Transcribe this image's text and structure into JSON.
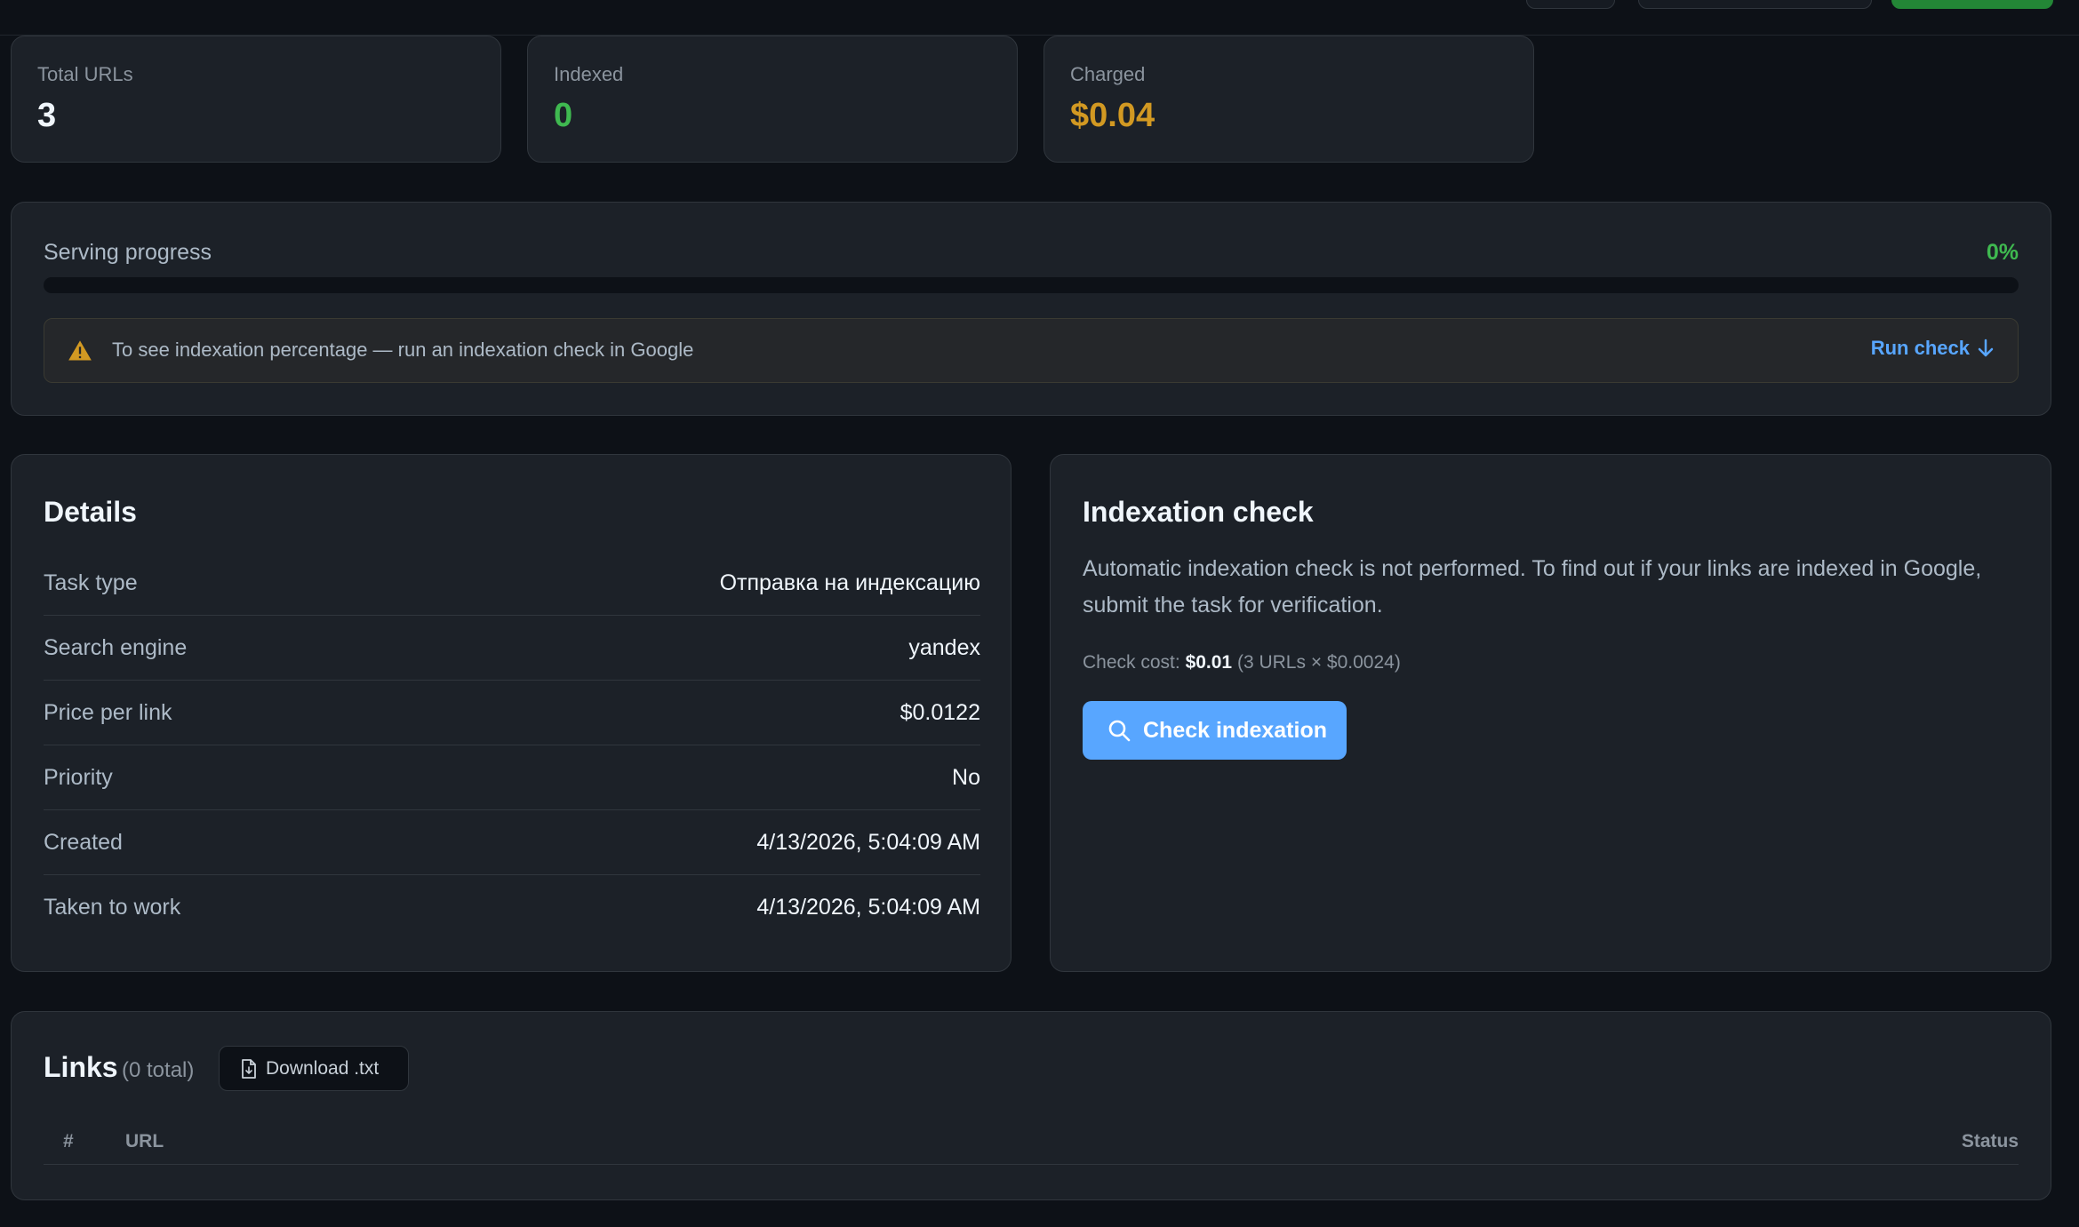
{
  "stats": {
    "total_urls_label": "Total URLs",
    "total_urls_value": "3",
    "indexed_label": "Indexed",
    "indexed_value": "0",
    "charged_label": "Charged",
    "charged_value": "$0.04"
  },
  "progress": {
    "label": "Serving progress",
    "percent_text": "0%",
    "fill_fraction": 0,
    "notice_text": "To see indexation percentage — run an indexation check in Google",
    "run_check_label": "Run check"
  },
  "details": {
    "title": "Details",
    "rows": [
      {
        "key": "Task type",
        "value": "Отправка на индексацию"
      },
      {
        "key": "Search engine",
        "value": "yandex"
      },
      {
        "key": "Price per link",
        "value": "$0.0122"
      },
      {
        "key": "Priority",
        "value": "No"
      },
      {
        "key": "Created",
        "value": "4/13/2026, 5:04:09 AM"
      },
      {
        "key": "Taken to work",
        "value": "4/13/2026, 5:04:09 AM"
      }
    ]
  },
  "indexation": {
    "title": "Indexation check",
    "description": "Automatic indexation check is not performed. To find out if your links are indexed in Google, submit the task for verification.",
    "cost_label": "Check cost:",
    "cost_value": "$0.01",
    "cost_detail": "(3 URLs × $0.0024)",
    "button_label": "Check indexation"
  },
  "links": {
    "title": "Links",
    "count_text": "(0 total)",
    "download_label": "Download .txt",
    "columns": {
      "num": "#",
      "url": "URL",
      "status": "Status"
    }
  },
  "colors": {
    "background": "#0d1117",
    "card": "#1c2128",
    "accent_blue": "#58a6ff",
    "green": "#3fb950",
    "amber": "#d29922"
  }
}
